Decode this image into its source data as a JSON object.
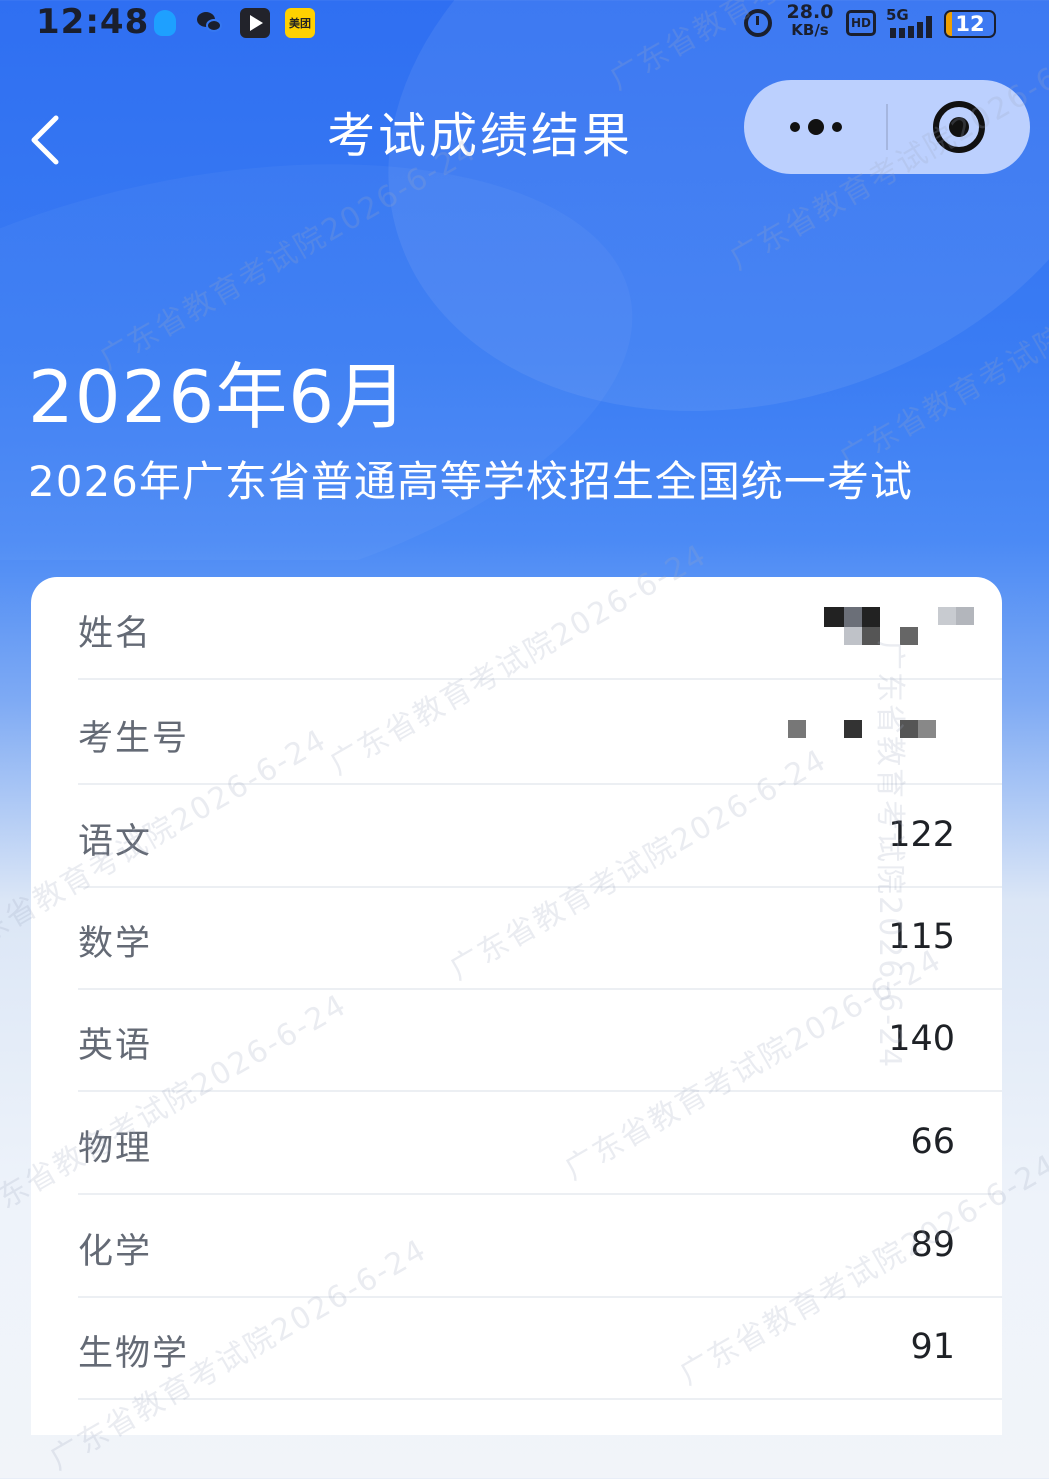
{
  "status_bar": {
    "time": "12:48",
    "net_speed_value": "28.0",
    "net_speed_unit": "KB/s",
    "hd_label": "HD",
    "network": "5G",
    "battery_level": "12",
    "meituan_label": "美团",
    "icons": [
      "qq-icon",
      "wechat-icon",
      "video-app-icon",
      "meituan-icon",
      "alarm-icon",
      "hd-icon",
      "signal-icon",
      "battery-icon"
    ]
  },
  "nav": {
    "title": "考试成绩结果",
    "back_icon": "chevron-left-icon",
    "more_icon": "more-dots-icon",
    "close_icon": "target-circle-icon"
  },
  "header": {
    "date": "2026年6月",
    "exam_name": "2026年广东省普通高等学校招生全国统一考试"
  },
  "results": {
    "name_label": "姓名",
    "exam_no_label": "考生号",
    "subjects": [
      {
        "name": "语文",
        "score": "122"
      },
      {
        "name": "数学",
        "score": "115"
      },
      {
        "name": "英语",
        "score": "140"
      },
      {
        "name": "物理",
        "score": "66"
      },
      {
        "name": "化学",
        "score": "89"
      },
      {
        "name": "生物学",
        "score": "91"
      }
    ]
  },
  "watermark": {
    "text": "广东省教育考试院2026-6-24"
  },
  "colors": {
    "header_blue": "#2f6ff2",
    "card_bg": "#ffffff",
    "label_gray": "#646a75",
    "value_dark": "#1e2126",
    "capsule_bg": "#cddcff",
    "battery_fill": "#f0a000",
    "qq_blue": "#1ea0ff",
    "meituan_yellow": "#ffd100"
  }
}
